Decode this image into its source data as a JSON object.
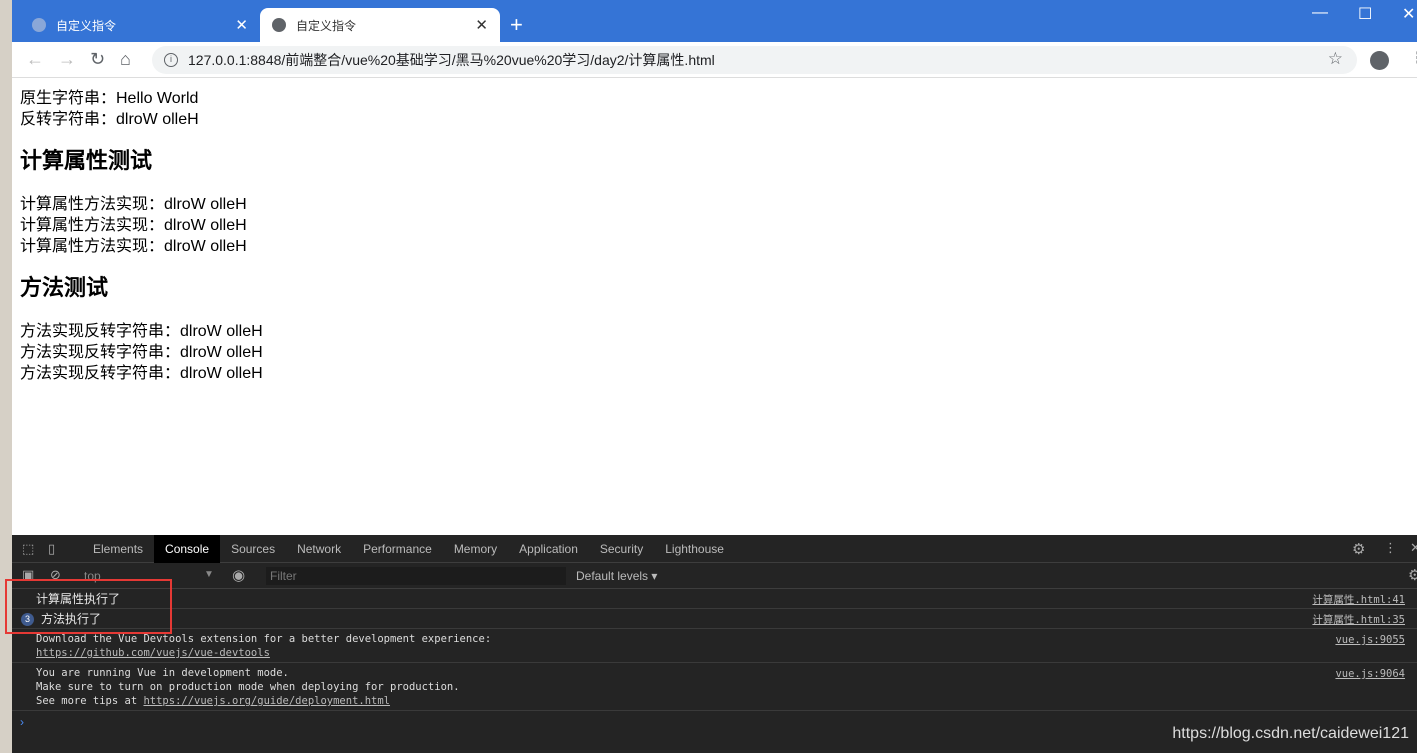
{
  "browser": {
    "tabs": [
      {
        "title": "自定义指令",
        "active": false
      },
      {
        "title": "自定义指令",
        "active": true
      }
    ],
    "url": "127.0.0.1:8848/前端整合/vue%20基础学习/黑马%20vue%20学习/day2/计算属性.html",
    "accent": "#3574d6"
  },
  "page": {
    "original": "原生字符串：Hello World",
    "reversed": "反转字符串：dlroW olleH",
    "computed_heading": "计算属性测试",
    "computed_lines": [
      "计算属性方法实现：dlroW olleH",
      "计算属性方法实现：dlroW olleH",
      "计算属性方法实现：dlroW olleH"
    ],
    "method_heading": "方法测试",
    "method_lines": [
      "方法实现反转字符串：dlroW olleH",
      "方法实现反转字符串：dlroW olleH",
      "方法实现反转字符串：dlroW olleH"
    ]
  },
  "devtools": {
    "tabs": [
      "Elements",
      "Console",
      "Sources",
      "Network",
      "Performance",
      "Memory",
      "Application",
      "Security",
      "Lighthouse"
    ],
    "active_tab": "Console",
    "context": "top",
    "filter_placeholder": "Filter",
    "levels": "Default levels ▾",
    "messages": [
      {
        "text": "计算属性执行了",
        "source": "计算属性.html:41"
      },
      {
        "count": "3",
        "text": "方法执行了",
        "source": "计算属性.html:35"
      },
      {
        "line1": "Download the Vue Devtools extension for a better development experience:",
        "link": "https://github.com/vuejs/vue-devtools",
        "source": "vue.js:9055"
      },
      {
        "line1": "You are running Vue in development mode.",
        "line2": "Make sure to turn on production mode when deploying for production.",
        "line3_prefix": "See more tips at ",
        "link": "https://vuejs.org/guide/deployment.html",
        "source": "vue.js:9064"
      }
    ]
  },
  "watermark": "https://blog.csdn.net/caidewei121"
}
